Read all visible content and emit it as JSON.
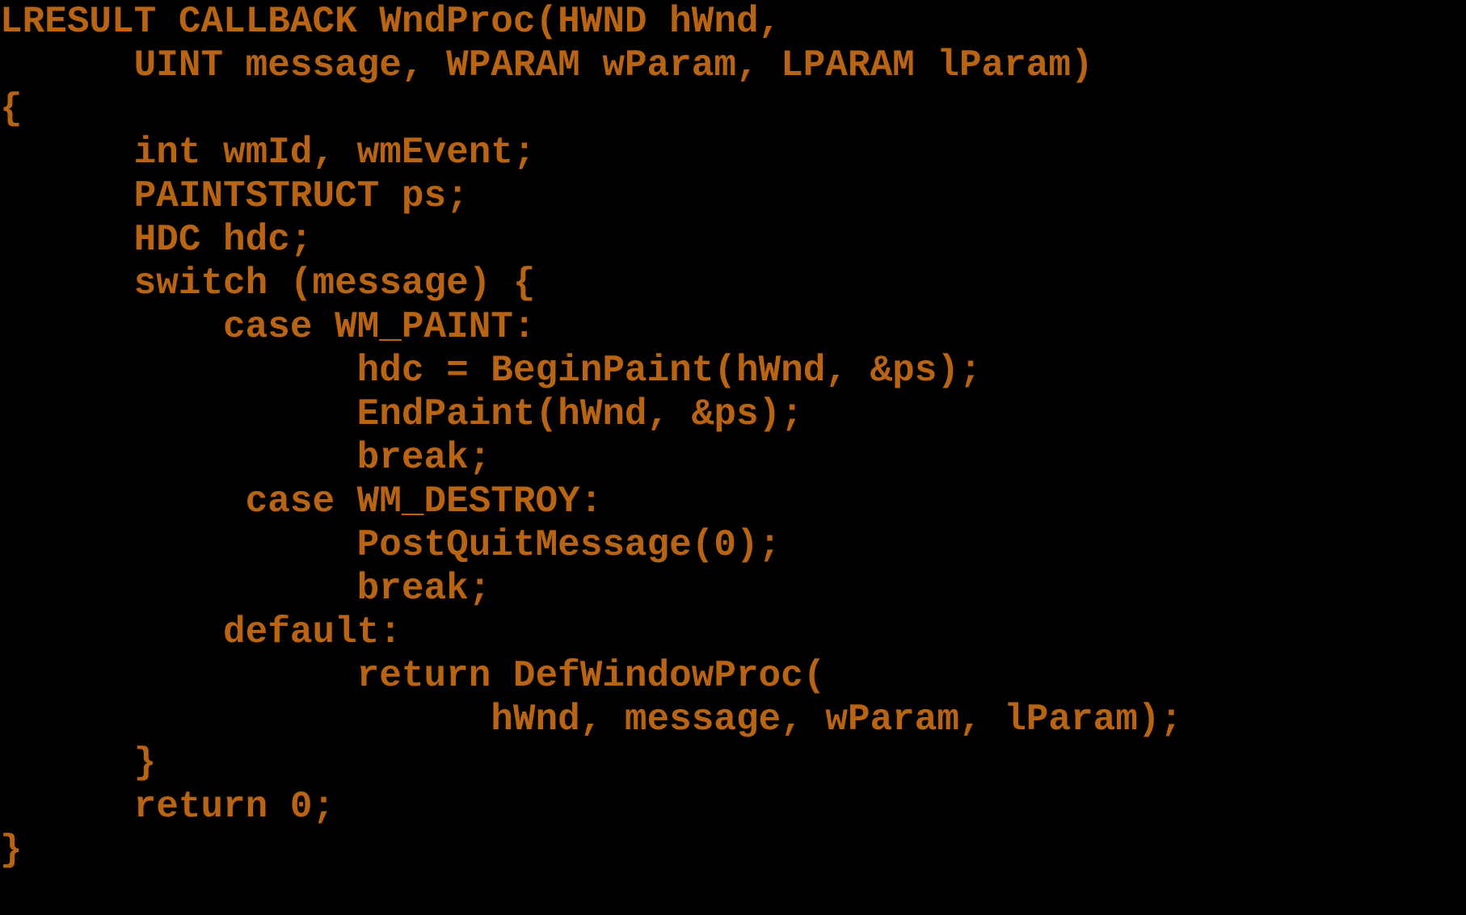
{
  "code": {
    "lines": [
      "LRESULT CALLBACK WndProc(HWND hWnd,",
      "      UINT message, WPARAM wParam, LPARAM lParam)",
      "{",
      "      int wmId, wmEvent;",
      "      PAINTSTRUCT ps;",
      "      HDC hdc;",
      "      switch (message) {",
      "          case WM_PAINT:",
      "                hdc = BeginPaint(hWnd, &ps);",
      "                EndPaint(hWnd, &ps);",
      "                break;",
      "           case WM_DESTROY:",
      "                PostQuitMessage(0);",
      "                break;",
      "          default:",
      "                return DefWindowProc(",
      "                      hWnd, message, wParam, lParam);",
      "      }",
      "      return 0;",
      "}"
    ]
  },
  "colors": {
    "background": "#000000",
    "text": "#b86412"
  }
}
